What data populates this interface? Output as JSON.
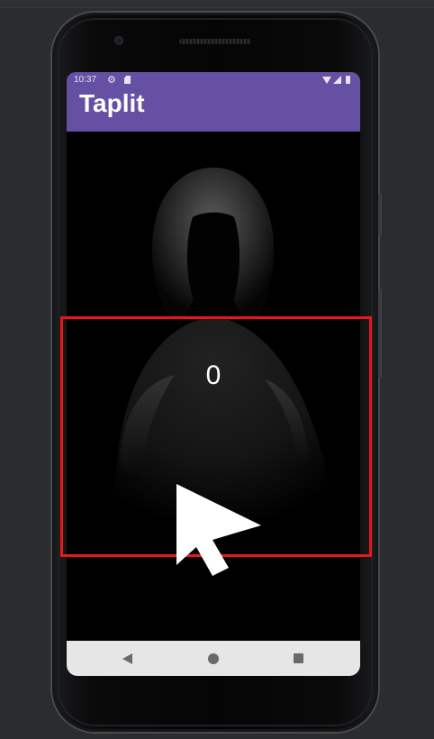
{
  "statusbar": {
    "time": "10:37",
    "icons": [
      "gear-icon",
      "sd-card-icon",
      "wifi-icon",
      "signal-icon",
      "battery-icon"
    ]
  },
  "app": {
    "title": "Taplit",
    "counter": "0"
  },
  "navbar": {
    "icons": [
      "back-icon",
      "home-icon",
      "recents-icon"
    ]
  },
  "colors": {
    "accent": "#6650a4",
    "tap_zone_border": "#e8171c",
    "screen_background": "#000000",
    "navbar_background": "#e6e6e6"
  }
}
